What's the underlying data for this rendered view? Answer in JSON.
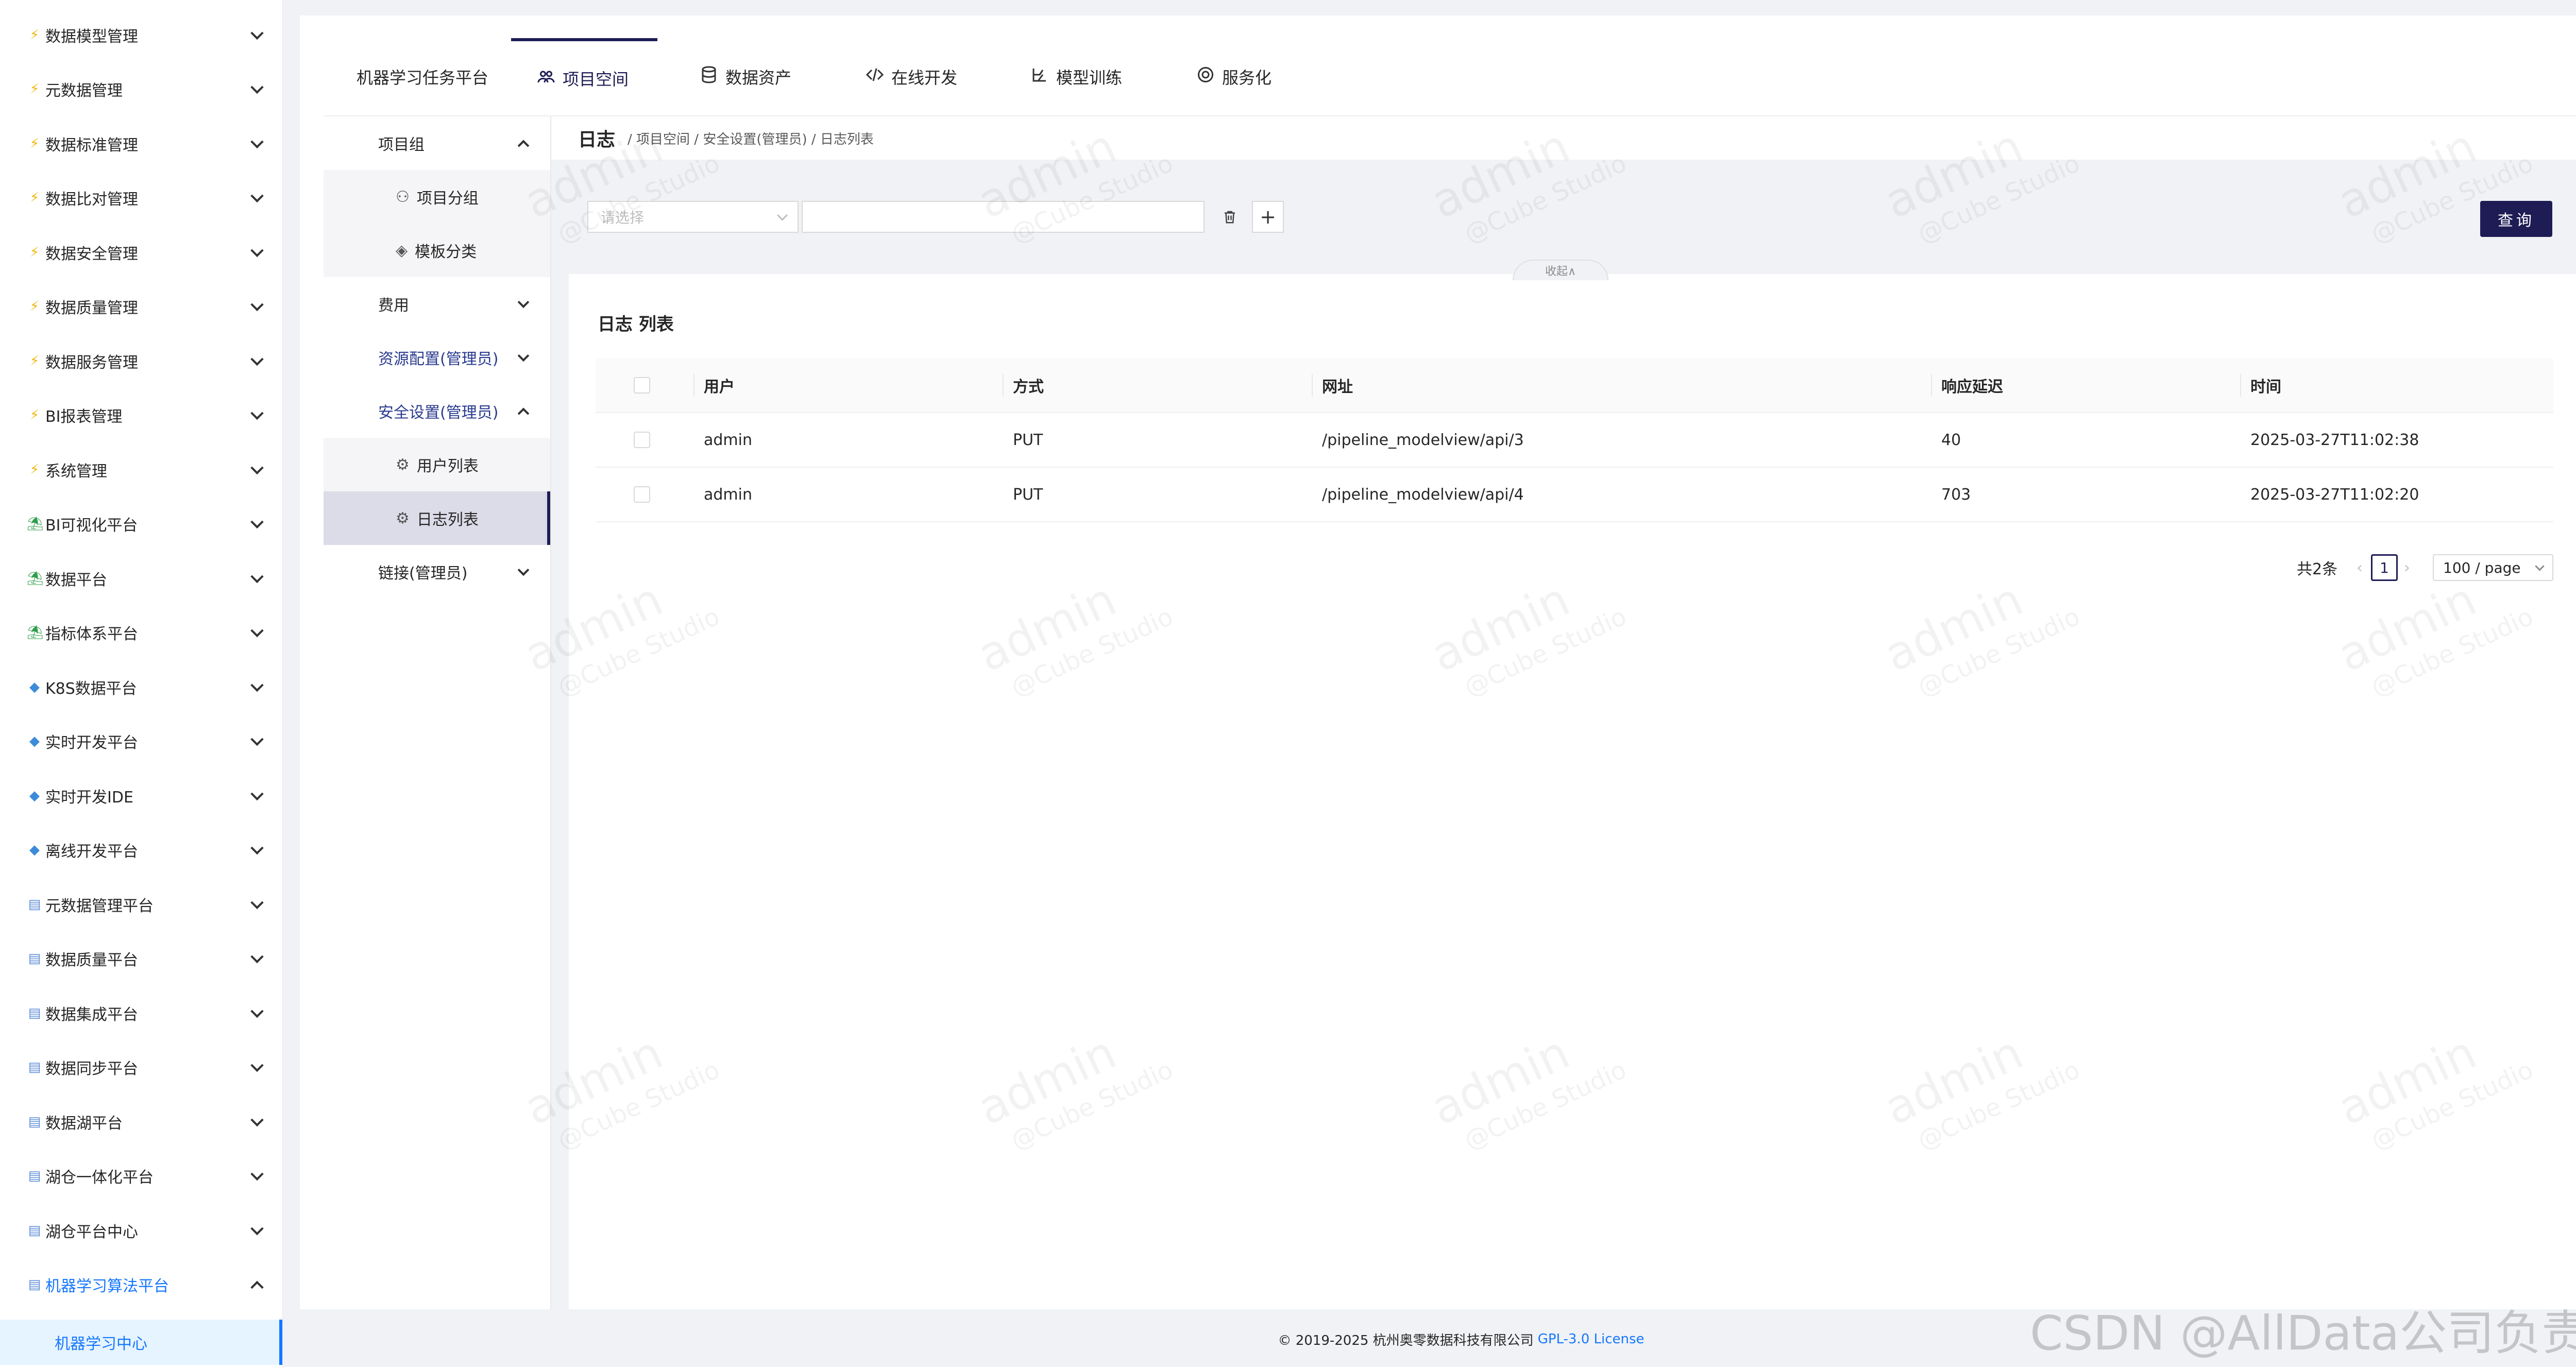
{
  "sidebar": {
    "items": [
      {
        "label": "数据模型管理",
        "icon": "bolt-icon"
      },
      {
        "label": "元数据管理",
        "icon": "bolt-icon"
      },
      {
        "label": "数据标准管理",
        "icon": "bolt-icon"
      },
      {
        "label": "数据比对管理",
        "icon": "bolt-icon"
      },
      {
        "label": "数据安全管理",
        "icon": "bolt-icon"
      },
      {
        "label": "数据质量管理",
        "icon": "bolt-icon"
      },
      {
        "label": "数据服务管理",
        "icon": "bolt-icon"
      },
      {
        "label": "BI报表管理",
        "icon": "bolt-icon"
      },
      {
        "label": "系统管理",
        "icon": "bolt-icon"
      },
      {
        "label": "BI可视化平台",
        "icon": "palm-icon"
      },
      {
        "label": "数据平台",
        "icon": "palm-icon"
      },
      {
        "label": "指标体系平台",
        "icon": "palm-icon"
      },
      {
        "label": "K8S数据平台",
        "icon": "gem-icon"
      },
      {
        "label": "实时开发平台",
        "icon": "gem-icon"
      },
      {
        "label": "实时开发IDE",
        "icon": "gem-icon"
      },
      {
        "label": "离线开发平台",
        "icon": "gem-icon"
      },
      {
        "label": "元数据管理平台",
        "icon": "box-icon"
      },
      {
        "label": "数据质量平台",
        "icon": "box-icon"
      },
      {
        "label": "数据集成平台",
        "icon": "box-icon"
      },
      {
        "label": "数据同步平台",
        "icon": "box-icon"
      },
      {
        "label": "数据湖平台",
        "icon": "box-icon"
      },
      {
        "label": "湖仓一体化平台",
        "icon": "box-icon"
      },
      {
        "label": "湖仓平台中心",
        "icon": "box-icon"
      },
      {
        "label": "机器学习算法平台",
        "icon": "box-icon"
      }
    ],
    "active_sub": "机器学习中心"
  },
  "topnav": {
    "tabs": [
      {
        "label": "机器学习任务平台",
        "icon": ""
      },
      {
        "label": "项目空间",
        "icon": "team-icon"
      },
      {
        "label": "数据资产",
        "icon": "database-icon"
      },
      {
        "label": "在线开发",
        "icon": "code-icon"
      },
      {
        "label": "模型训练",
        "icon": "training-icon"
      },
      {
        "label": "服务化",
        "icon": "api-icon"
      }
    ],
    "active_index": 1
  },
  "submenu": {
    "project_group": "项目组",
    "project_subgroup": "项目分组",
    "template_category": "模板分类",
    "cost": "费用",
    "resource_config": "资源配置(管理员)",
    "security_settings": "安全设置(管理员)",
    "user_list": "用户列表",
    "log_list": "日志列表",
    "links": "链接(管理员)"
  },
  "breadcrumb": {
    "title": "日志",
    "path": "/ 项目空间 / 安全设置(管理员) / 日志列表"
  },
  "filter": {
    "select_placeholder": "请选择",
    "query_label": "查询",
    "collapse_label": "收起∧"
  },
  "list": {
    "title": "日志 列表",
    "columns": [
      "用户",
      "方式",
      "网址",
      "响应延迟",
      "时间"
    ],
    "rows": [
      [
        "admin",
        "PUT",
        "/pipeline_modelview/api/3",
        "40",
        "2025-03-27T11:02:38"
      ],
      [
        "admin",
        "PUT",
        "/pipeline_modelview/api/4",
        "703",
        "2025-03-27T11:02:20"
      ]
    ]
  },
  "pagination": {
    "total": "共2条",
    "current_page": "1",
    "page_size": "100 / page"
  },
  "watermark": {
    "line1": "admin",
    "line2": "@Cube Studio"
  },
  "footer": {
    "copyright": "© 2019-2025 杭州奥零数据科技有限公司",
    "license": "GPL-3.0 License"
  },
  "overlay_watermark": "CSDN @AllData公司负责人",
  "colors": {
    "primary": "#1e1c55",
    "link": "#1677ff",
    "background": "#f0f2f5"
  }
}
